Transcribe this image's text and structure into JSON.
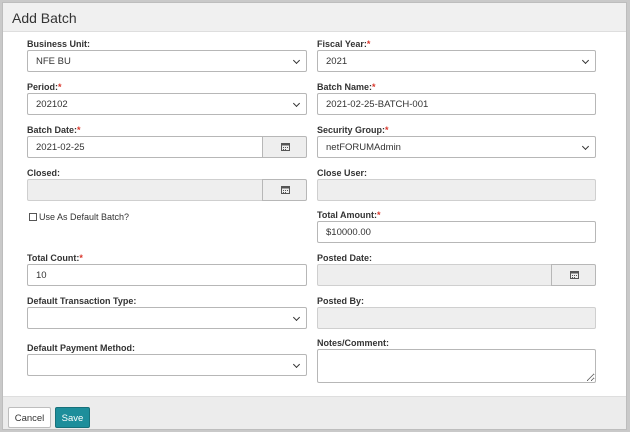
{
  "dialog": {
    "title": "Add Batch"
  },
  "fields": {
    "business_unit": {
      "label": "Business Unit:",
      "value": "NFE BU"
    },
    "fiscal_year": {
      "label": "Fiscal Year:",
      "value": "2021",
      "required": "*"
    },
    "period": {
      "label": "Period:",
      "value": "202102",
      "required": "*"
    },
    "batch_name": {
      "label": "Batch Name:",
      "value": "2021-02-25-BATCH-001",
      "required": "*"
    },
    "batch_date": {
      "label": "Batch Date:",
      "value": "2021-02-25",
      "required": "*"
    },
    "security_group": {
      "label": "Security Group:",
      "value": "netFORUMAdmin",
      "required": "*"
    },
    "closed": {
      "label": "Closed:",
      "value": ""
    },
    "close_user": {
      "label": "Close User:",
      "value": ""
    },
    "use_default": {
      "label": "Use As Default Batch?"
    },
    "total_amount": {
      "label": "Total Amount:",
      "value": "$10000.00",
      "required": "*"
    },
    "total_count": {
      "label": "Total Count:",
      "value": "10",
      "required": "*"
    },
    "posted_date": {
      "label": "Posted Date:",
      "value": ""
    },
    "default_transaction_type": {
      "label": "Default Transaction Type:",
      "value": ""
    },
    "posted_by": {
      "label": "Posted By:",
      "value": ""
    },
    "default_payment_method": {
      "label": "Default Payment Method:",
      "value": ""
    },
    "notes": {
      "label": "Notes/Comment:",
      "value": ""
    }
  },
  "footer": {
    "cancel_label": "Cancel",
    "save_label": "Save"
  },
  "icons": {
    "calendar": "calendar-icon",
    "dropdown": "chevron-down-icon"
  },
  "colors": {
    "required": "#d9362b",
    "primary_button": "#1d8e9b",
    "header_bg": "#f0f0f0"
  }
}
